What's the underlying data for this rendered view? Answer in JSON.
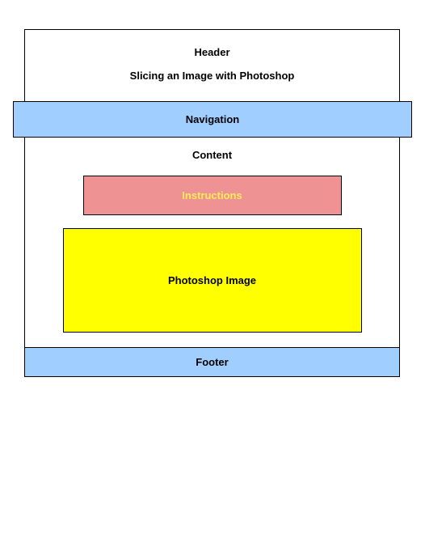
{
  "header": {
    "title": "Header",
    "subtitle": "Slicing an Image with Photoshop"
  },
  "navigation": {
    "label": "Navigation"
  },
  "content": {
    "label": "Content",
    "instructions": {
      "label": "Instructions"
    },
    "photoshop": {
      "label": "Photoshop Image"
    }
  },
  "footer": {
    "label": "Footer"
  },
  "colors": {
    "lightblue": "#a0cfff",
    "salmon": "#ef9294",
    "yellow": "#ffff00",
    "yellowtext": "#ffed55"
  }
}
